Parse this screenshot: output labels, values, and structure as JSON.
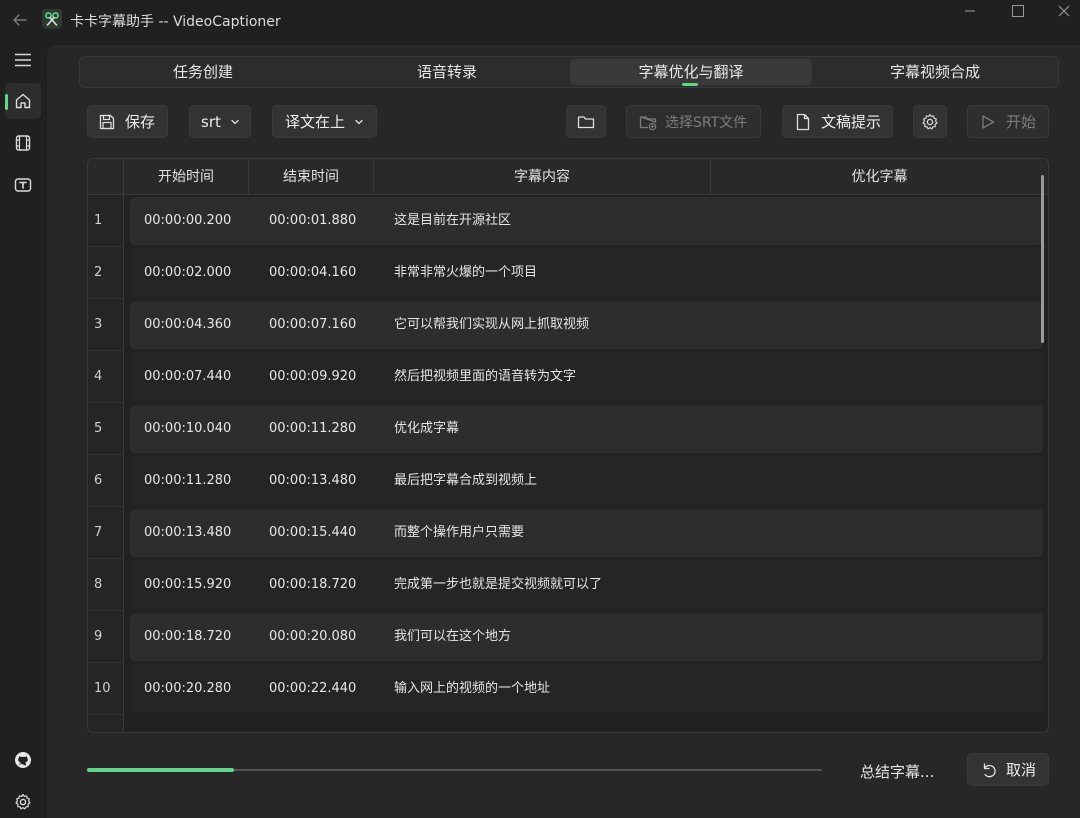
{
  "window": {
    "title": "卡卡字幕助手 -- VideoCaptioner",
    "accent": "#5fd68a"
  },
  "rail": {
    "items": [
      {
        "icon": "home-icon",
        "active": true
      },
      {
        "icon": "film-icon",
        "active": false
      },
      {
        "icon": "subtitle-icon",
        "active": false
      }
    ],
    "bottom": [
      {
        "icon": "github-icon"
      },
      {
        "icon": "settings-gear-icon"
      }
    ]
  },
  "tabs": [
    {
      "label": "任务创建",
      "active": false
    },
    {
      "label": "语音转录",
      "active": false
    },
    {
      "label": "字幕优化与翻译",
      "active": true
    },
    {
      "label": "字幕视频合成",
      "active": false
    }
  ],
  "toolbar": {
    "save_label": "保存",
    "format_value": "srt",
    "layout_value": "译文在上",
    "select_srt_label": "选择SRT文件",
    "prompt_label": "文稿提示",
    "start_label": "开始"
  },
  "table": {
    "headers": [
      "开始时间",
      "结束时间",
      "字幕内容",
      "优化字幕"
    ],
    "rows": [
      {
        "idx": "1",
        "start": "00:00:00.200",
        "end": "00:00:01.880",
        "text": "这是目前在开源社区",
        "optimized": ""
      },
      {
        "idx": "2",
        "start": "00:00:02.000",
        "end": "00:00:04.160",
        "text": "非常非常火爆的一个项目",
        "optimized": ""
      },
      {
        "idx": "3",
        "start": "00:00:04.360",
        "end": "00:00:07.160",
        "text": "它可以帮我们实现从网上抓取视频",
        "optimized": ""
      },
      {
        "idx": "4",
        "start": "00:00:07.440",
        "end": "00:00:09.920",
        "text": "然后把视频里面的语音转为文字",
        "optimized": ""
      },
      {
        "idx": "5",
        "start": "00:00:10.040",
        "end": "00:00:11.280",
        "text": "优化成字幕",
        "optimized": ""
      },
      {
        "idx": "6",
        "start": "00:00:11.280",
        "end": "00:00:13.480",
        "text": "最后把字幕合成到视频上",
        "optimized": ""
      },
      {
        "idx": "7",
        "start": "00:00:13.480",
        "end": "00:00:15.440",
        "text": "而整个操作用户只需要",
        "optimized": ""
      },
      {
        "idx": "8",
        "start": "00:00:15.920",
        "end": "00:00:18.720",
        "text": "完成第一步也就是提交视频就可以了",
        "optimized": ""
      },
      {
        "idx": "9",
        "start": "00:00:18.720",
        "end": "00:00:20.080",
        "text": "我们可以在这个地方",
        "optimized": ""
      },
      {
        "idx": "10",
        "start": "00:00:20.280",
        "end": "00:00:22.440",
        "text": "输入网上的视频的一个地址",
        "optimized": ""
      }
    ]
  },
  "bottom": {
    "progress_percent": 20,
    "status_text": "总结字幕...",
    "cancel_label": "取消"
  }
}
